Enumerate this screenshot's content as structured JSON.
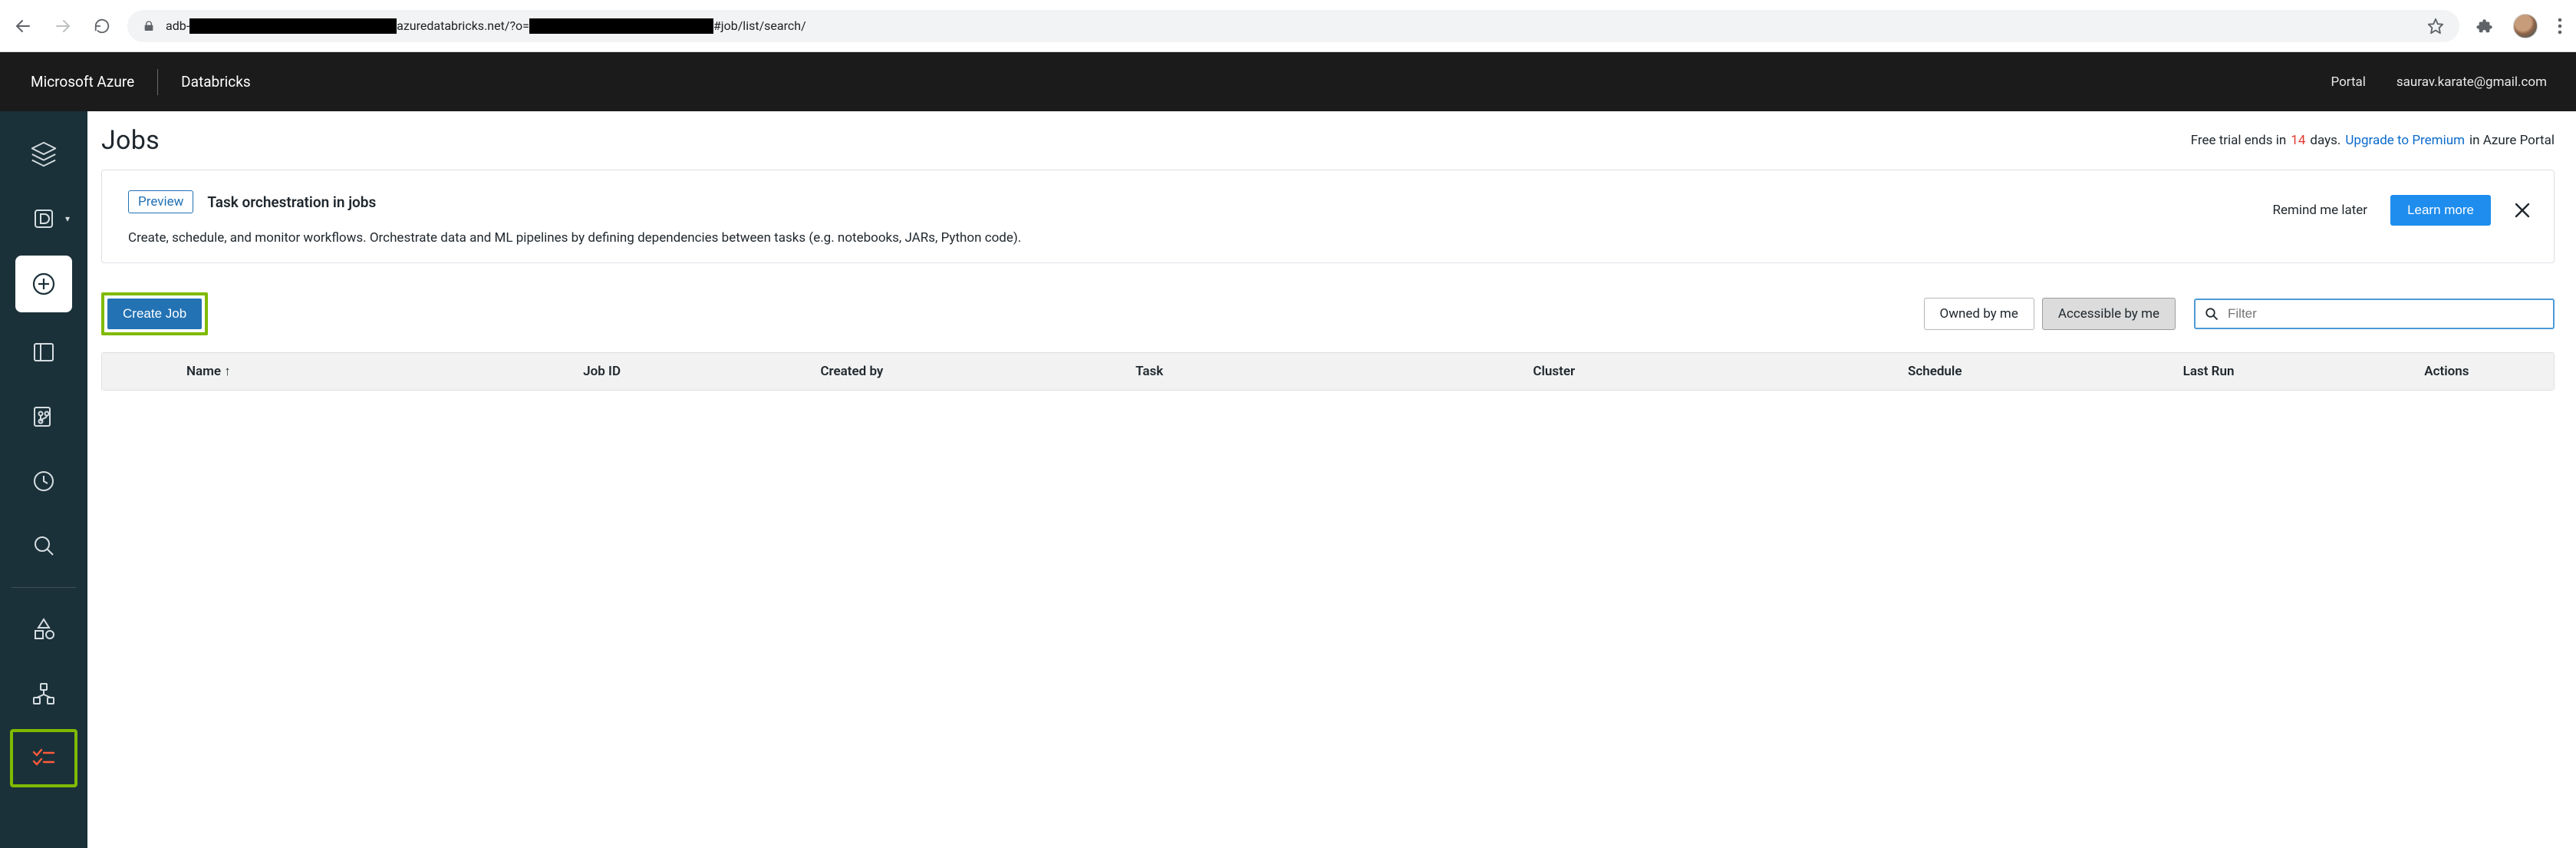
{
  "browser": {
    "url_parts": {
      "prefix": "adb-",
      "mid": "azuredatabricks.net/?o=",
      "suffix": "#job/list/search/"
    }
  },
  "header": {
    "brand_primary": "Microsoft Azure",
    "brand_secondary": "Databricks",
    "right": {
      "portal": "Portal",
      "user_email": "saurav.karate@gmail.com"
    }
  },
  "page": {
    "title": "Jobs",
    "trial": {
      "prefix": "Free trial ends in ",
      "days": "14",
      "days_suffix": " days. ",
      "upgrade_link": "Upgrade to Premium",
      "portal_suffix": " in Azure Portal"
    }
  },
  "banner": {
    "tag": "Preview",
    "title": "Task orchestration in jobs",
    "desc": "Create, schedule, and monitor workflows. Orchestrate data and ML pipelines by defining dependencies between tasks (e.g. notebooks, JARs, Python code).",
    "remind": "Remind me later",
    "learn_more": "Learn more"
  },
  "toolbar": {
    "create_job": "Create Job",
    "owned_by_me": "Owned by me",
    "accessible_by_me": "Accessible by me",
    "filter_placeholder": "Filter"
  },
  "table": {
    "columns": {
      "name": "Name",
      "job_id": "Job ID",
      "created_by": "Created by",
      "task": "Task",
      "cluster": "Cluster",
      "schedule": "Schedule",
      "last_run": "Last Run",
      "actions": "Actions"
    }
  },
  "sidebar": {
    "items": [
      {
        "id": "logo",
        "name": "databricks-logo-icon"
      },
      {
        "id": "workspace-picker",
        "name": "workspace-switcher-icon"
      },
      {
        "id": "create",
        "name": "create-new-icon"
      },
      {
        "id": "workspace",
        "name": "workspace-icon"
      },
      {
        "id": "repos",
        "name": "repos-icon"
      },
      {
        "id": "recents",
        "name": "recents-icon"
      },
      {
        "id": "search",
        "name": "search-icon"
      },
      {
        "id": "data",
        "name": "data-icon"
      },
      {
        "id": "compute",
        "name": "compute-icon"
      },
      {
        "id": "jobs",
        "name": "jobs-icon",
        "active": true
      }
    ]
  }
}
